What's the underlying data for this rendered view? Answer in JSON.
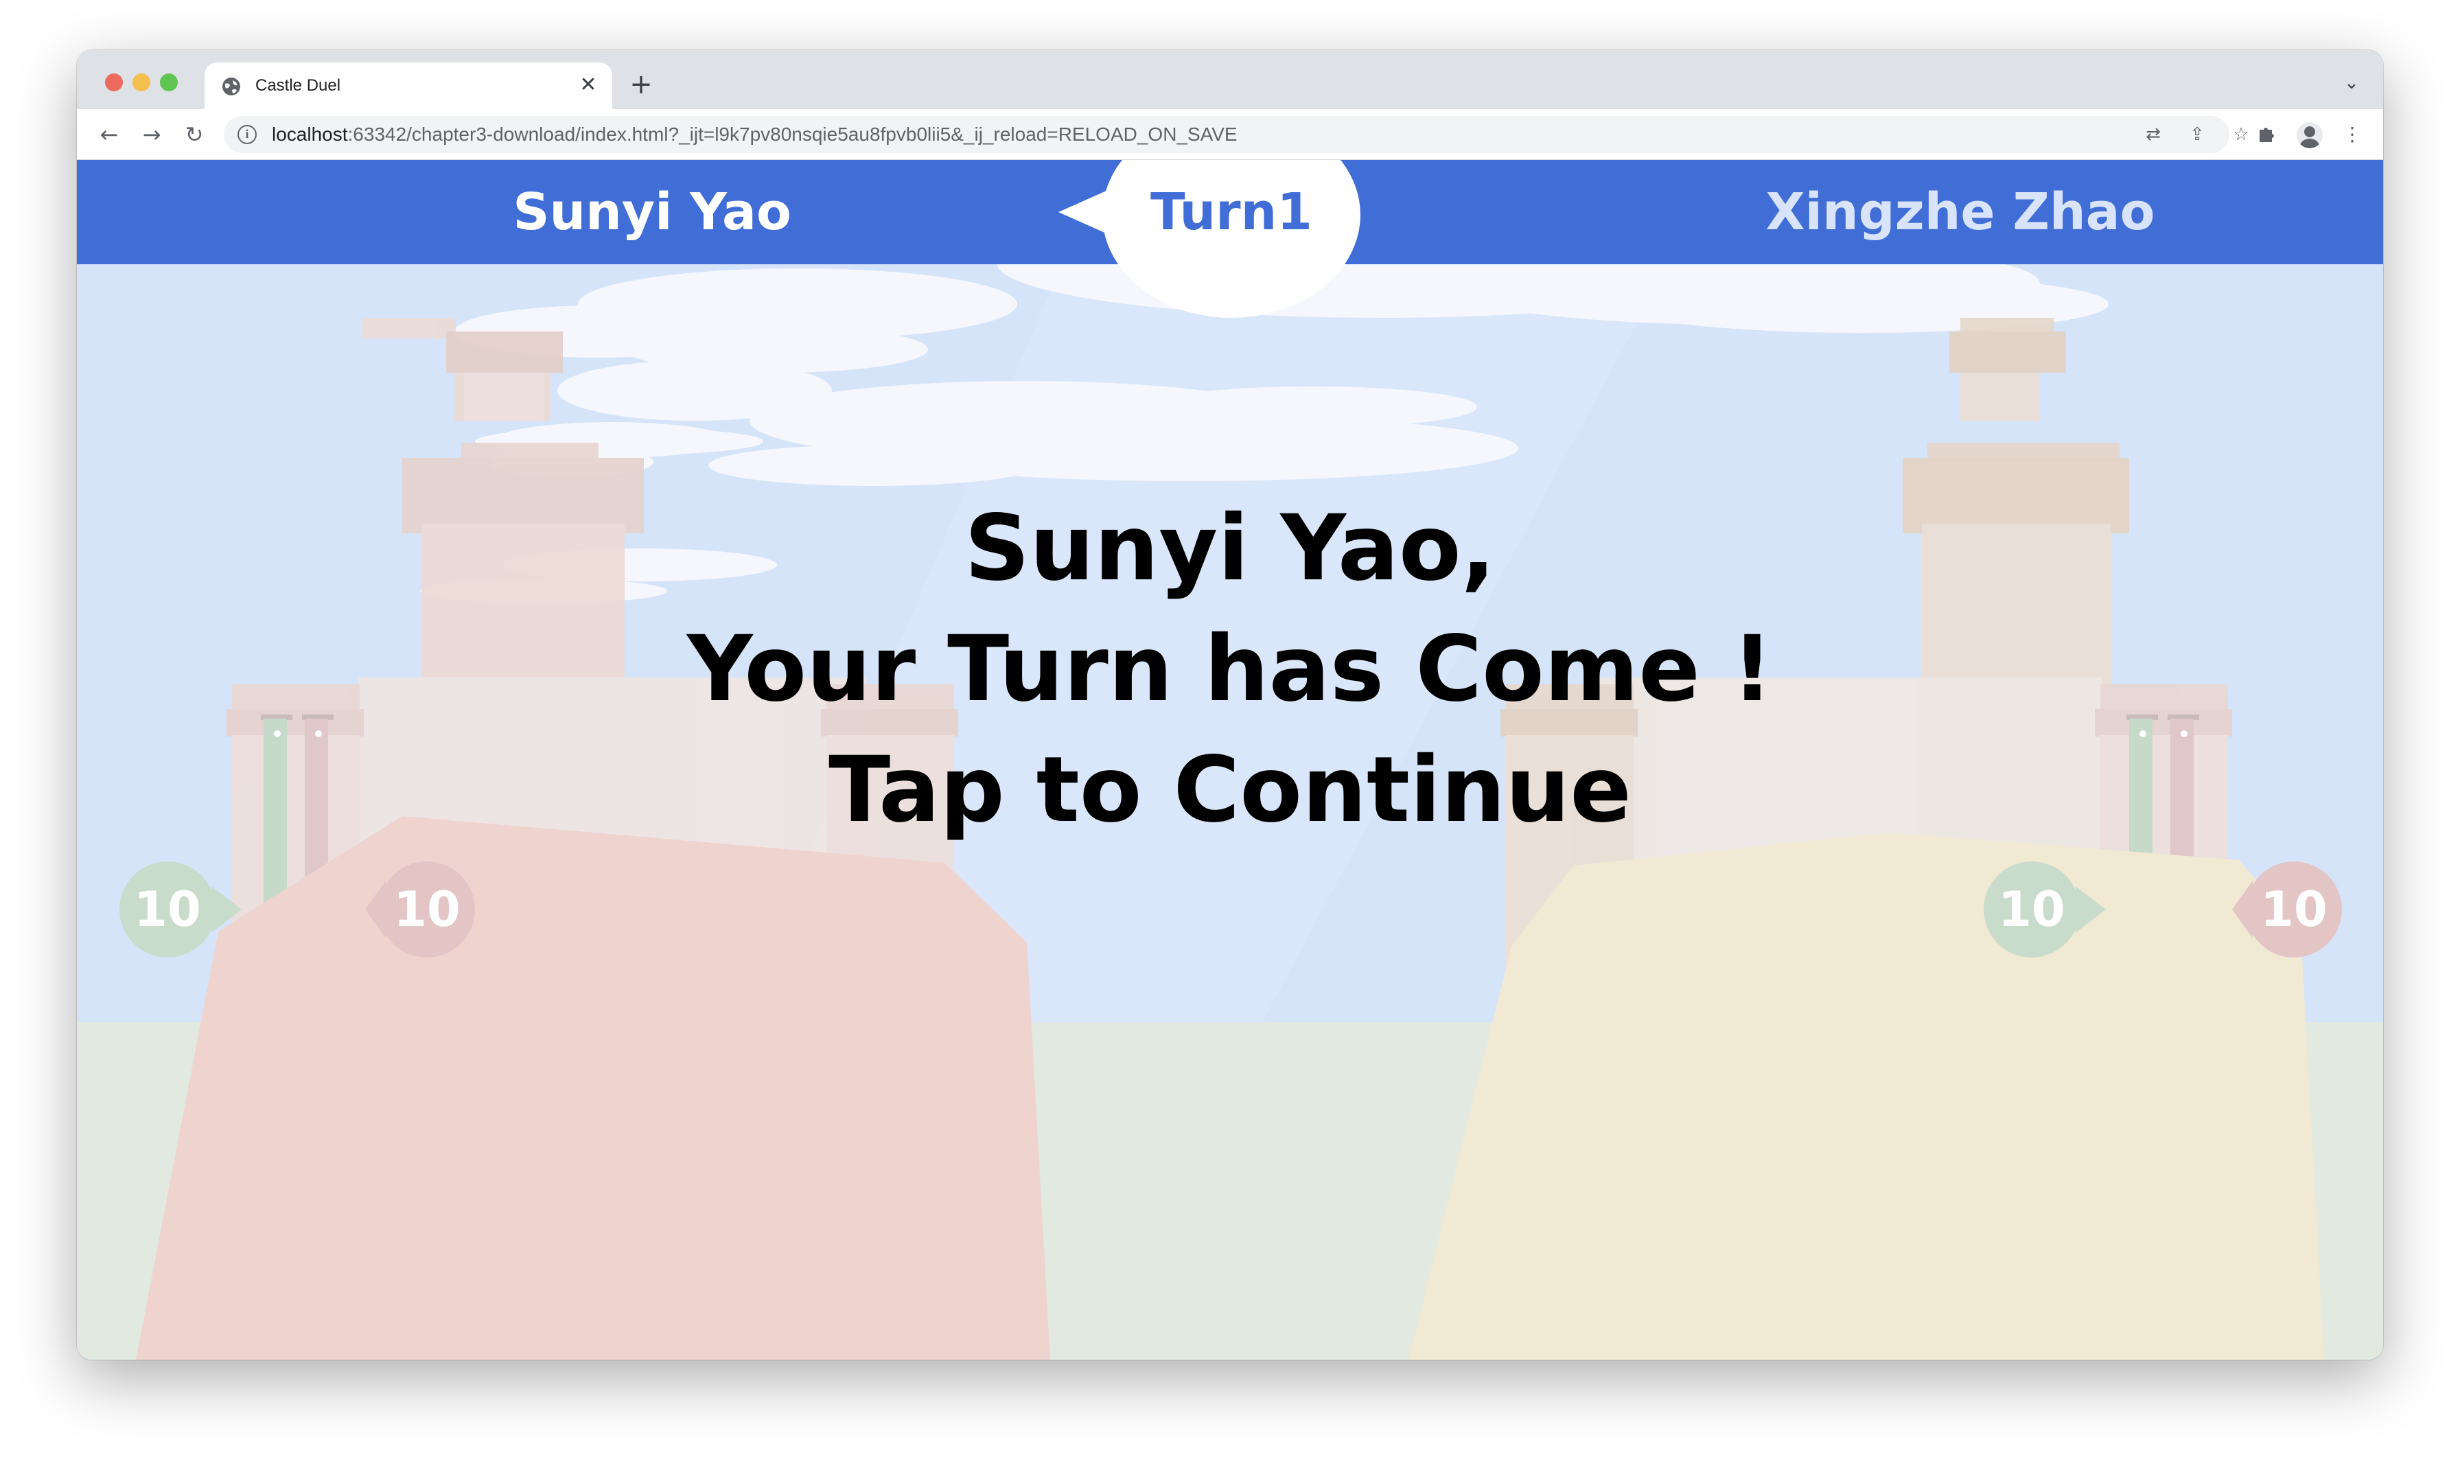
{
  "browser": {
    "tab_title": "Castle Duel",
    "url_host": "localhost",
    "url_rest": ":63342/chapter3-download/index.html?_ijt=l9k7pv80nsqie5au8fpvb0lii5&_ij_reload=RELOAD_ON_SAVE",
    "icons": {
      "close_tab": "close-icon",
      "new_tab": "plus-icon",
      "back": "arrow-left-icon",
      "forward": "arrow-right-icon",
      "reload": "reload-icon",
      "site_info": "info-icon",
      "translate": "translate-icon",
      "share": "share-icon",
      "bookmark": "star-icon",
      "extensions": "puzzle-icon",
      "profile": "avatar-icon",
      "menu": "kebab-menu-icon"
    }
  },
  "game": {
    "title": "Castle Duel",
    "player_left": "Sunyi Yao",
    "player_right": "Xingzhe Zhao",
    "turn_label": "Turn1",
    "overlay": {
      "line1": "Sunyi Yao,",
      "line2": "Your Turn has Come !",
      "line3": "Tap to Continue"
    },
    "left_castle": {
      "food": "10",
      "health": "10"
    },
    "right_castle": {
      "food": "10",
      "health": "10"
    },
    "colors": {
      "topbar": "#406dd6",
      "sky": "#d6e4f9",
      "food_badge": "#c9dccb",
      "health_badge": "#e3c5c6",
      "left_hill": "#efd3cf",
      "right_hill": "#f1e9d3"
    }
  }
}
